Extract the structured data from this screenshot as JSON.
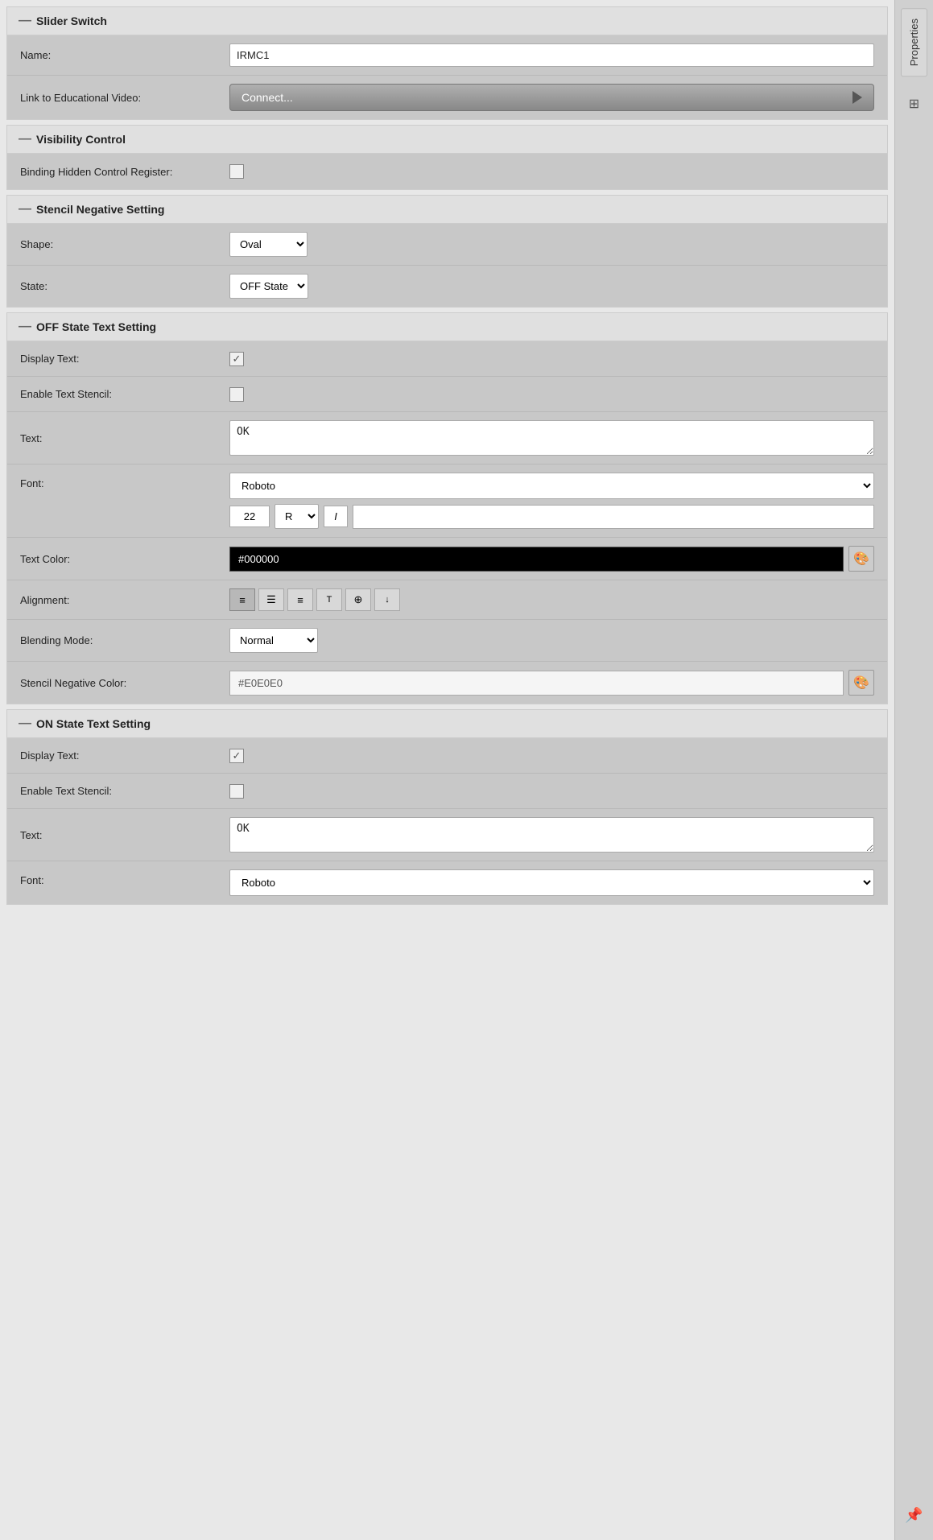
{
  "sections": {
    "slider_switch": {
      "title": "Slider Switch",
      "fields": {
        "name_label": "Name:",
        "name_value": "IRMC1",
        "video_label": "Link to Educational Video:",
        "video_btn": "Connect..."
      }
    },
    "visibility_control": {
      "title": "Visibility Control",
      "fields": {
        "binding_label": "Binding Hidden Control Register:",
        "binding_checked": false
      }
    },
    "stencil_negative": {
      "title": "Stencil Negative Setting",
      "fields": {
        "shape_label": "Shape:",
        "shape_value": "Oval",
        "state_label": "State:",
        "state_value": "OFF State"
      }
    },
    "off_state_text": {
      "title": "OFF State Text Setting",
      "fields": {
        "display_text_label": "Display Text:",
        "display_text_checked": true,
        "enable_stencil_label": "Enable Text Stencil:",
        "enable_stencil_checked": false,
        "text_label": "Text:",
        "text_value": "OK",
        "font_label": "Font:",
        "font_value": "Roboto",
        "font_size": "22",
        "font_style": "R",
        "font_italic": "I",
        "text_color_label": "Text Color:",
        "text_color_value": "#000000",
        "alignment_label": "Alignment:",
        "blending_label": "Blending Mode:",
        "blending_value": "Normal",
        "stencil_neg_color_label": "Stencil Negative Color:",
        "stencil_neg_color_value": "#E0E0E0"
      }
    },
    "on_state_text": {
      "title": "ON State Text Setting",
      "fields": {
        "display_text_label": "Display Text:",
        "display_text_checked": true,
        "enable_stencil_label": "Enable Text Stencil:",
        "enable_stencil_checked": false,
        "text_label": "Text:",
        "text_value": "OK",
        "font_label": "Font:",
        "font_value": "Roboto"
      }
    }
  },
  "sidebar": {
    "properties_label": "Properties",
    "controls_icon": "⊞",
    "pin_icon": "📌"
  }
}
